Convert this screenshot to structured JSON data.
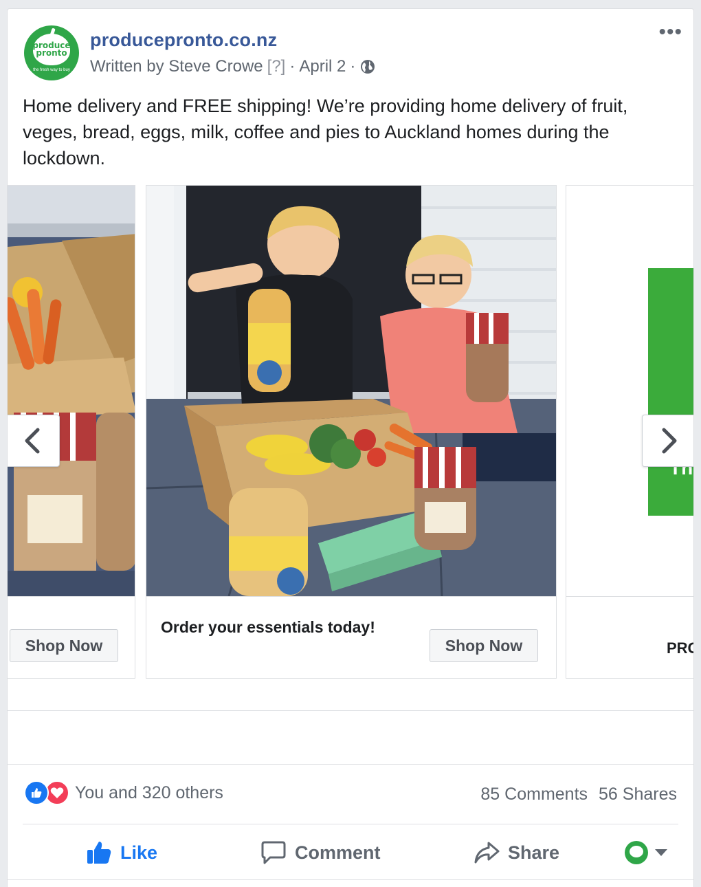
{
  "post": {
    "page_name": "producepronto.co.nz",
    "avatar": {
      "line1": "produce",
      "line2": "pronto",
      "tagline": "the fresh way to buy"
    },
    "written_by": "Written by Steve Crowe",
    "help_marker": "[?]",
    "separator": "·",
    "date": "April 2",
    "text": "Home delivery and FREE shipping! We’re providing home delivery of fruit, veges, bread, eggs, milk, coffee and pies to Auckland homes during the lockdown."
  },
  "carousel": {
    "cards": [
      {
        "headline": "",
        "cta": "Shop Now"
      },
      {
        "headline": "Order your essentials today!",
        "cta": "Shop Now"
      },
      {
        "headline": "PRC",
        "cta": ""
      }
    ]
  },
  "engagement": {
    "reactions_text": "You and 320 others",
    "comments": "85 Comments",
    "shares": "56 Shares"
  },
  "actions": {
    "like": "Like",
    "comment": "Comment",
    "share": "Share"
  },
  "colors": {
    "brand_green": "#2fa648",
    "link_blue": "#385898",
    "like_blue": "#1877f2",
    "love_red": "#f33e58"
  },
  "icons": [
    "globe-icon",
    "more-options-icon",
    "chevron-left-icon",
    "chevron-right-icon",
    "like-reaction-icon",
    "love-reaction-icon",
    "thumbs-up-icon",
    "comment-icon",
    "share-icon",
    "dropdown-caret-icon"
  ]
}
